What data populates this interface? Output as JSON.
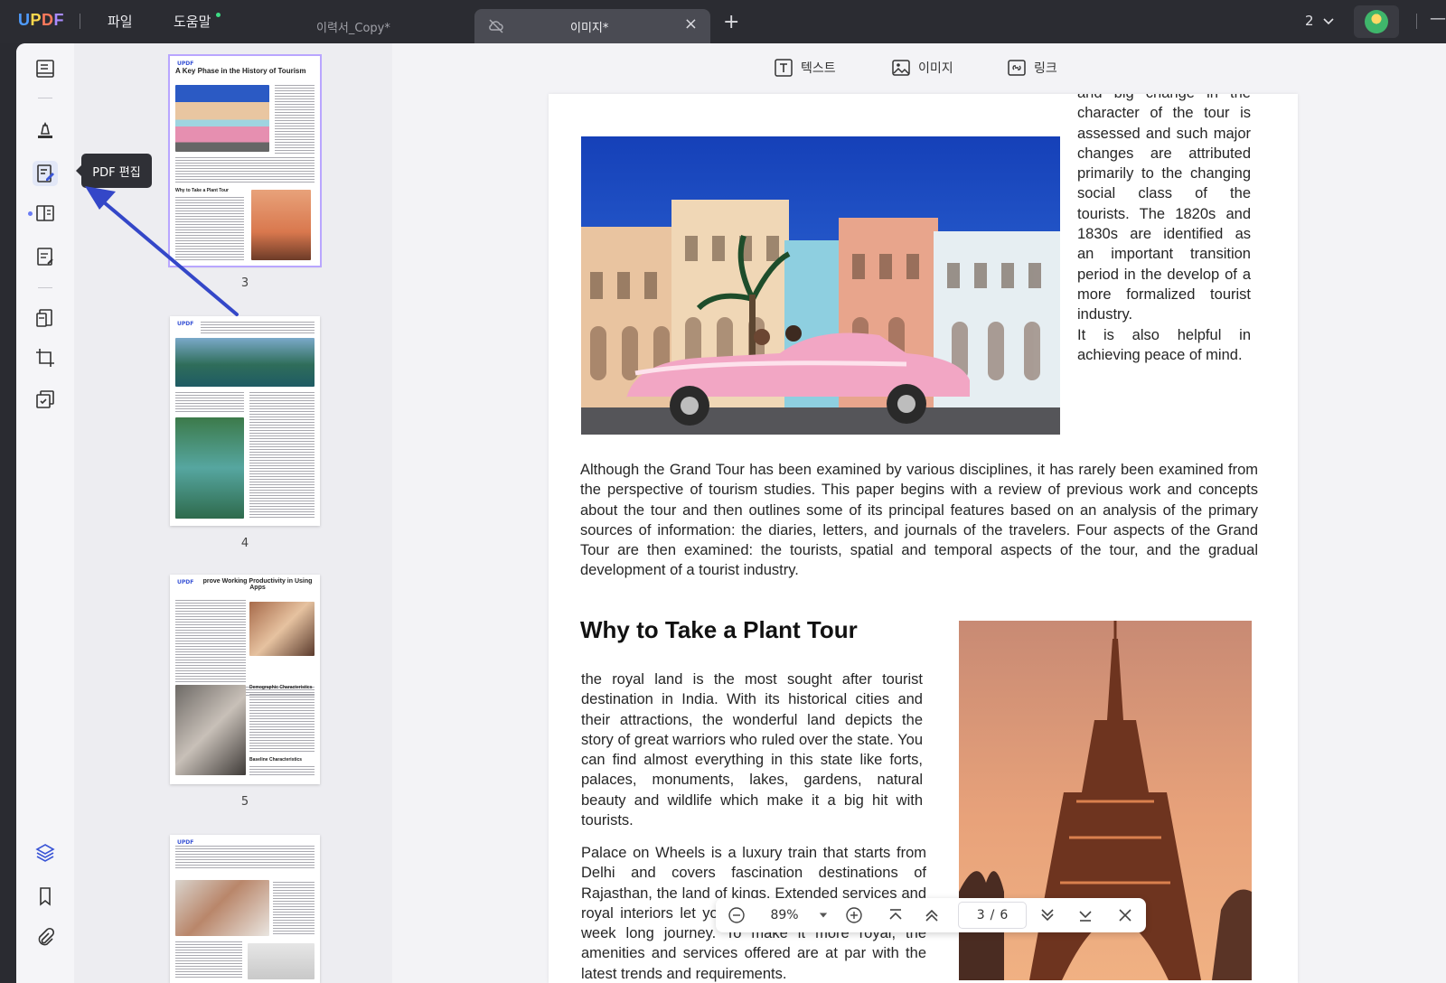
{
  "titlebar": {
    "logo": "UPDF",
    "menu_file": "파일",
    "menu_help": "도움말",
    "tab_inactive": "이력서_Copy*",
    "tab_active": "이미지*",
    "add_tab": "+",
    "window_count": "2",
    "minimize": "—"
  },
  "left_toolbar": {
    "items": [
      "reader-icon",
      "comment-icon",
      "edit-pdf-icon",
      "page-organize-icon",
      "form-icon",
      "convert-icon",
      "crop-icon",
      "protect-icon",
      "layers-icon",
      "bookmark-icon",
      "attachment-icon"
    ],
    "active": "edit-pdf-icon",
    "tooltip": "PDF 편집"
  },
  "thumbnails": {
    "pages": [
      {
        "number": "3",
        "title": "A Key Phase in the History of Tourism",
        "subheading": "Why to Take a Plant Tour",
        "brand": "UPDF"
      },
      {
        "number": "4",
        "brand": "UPDF"
      },
      {
        "number": "5",
        "title": "prove Working Productivity in Using Apps",
        "subheading1": "Demographic Characteristics",
        "subheading2": "Baseline Characteristics",
        "brand": "UPDF"
      },
      {
        "number": "",
        "brand": "UPDF"
      }
    ]
  },
  "edit_toolbar": {
    "text": "텍스트",
    "image": "이미지",
    "link": "링크"
  },
  "page": {
    "side_text_lines": [
      "and big change in the",
      "character of the tour is",
      "assessed and such major",
      "changes are attributed",
      "primarily to the changing",
      "social class of the",
      "tourists. The 1820s and",
      "1830s are identified as",
      "an important transition",
      "period in the develop of a",
      "more formalized tourist",
      "industry.",
      "It is also helpful in",
      "achieving peace of mind."
    ],
    "paragraph1": "Although the Grand Tour has been examined by various disciplines, it has rarely been examined from the perspective of tourism studies. This paper begins with a review of previous work and concepts about the tour and then outlines some of its principal features based on an analysis of the primary sources of information: the diaries, letters, and journals of the travelers. Four aspects of the Grand Tour are then examined: the tourists, spatial and temporal aspects of the tour, and the gradual development of a tourist industry.",
    "heading": "Why to Take a Plant Tour",
    "paragraph2": "the royal land is the most sought after tourist destination in India. With its historical cities and their attractions, the wonderful land depicts the story of great warriors who ruled over the state. You can find almost everything in this state like forts, palaces, monuments, lakes, gardens, natural beauty and wildlife which make it a big hit with tourists.",
    "paragraph3": "Palace on Wheels is a luxury train that starts from Delhi and covers fascination destinations of Rajasthan, the land of kings. Extended services and royal interiors let you feel like a king during the a week long journey. To make it more royal, the amenities and services offered are at par with the latest trends and requirements."
  },
  "nav": {
    "zoom": "89%",
    "current_page": "3",
    "separator": "/",
    "total_pages": "6"
  },
  "colors": {
    "accent": "#3a55d6",
    "titlebar_bg": "#2b2c32",
    "selection": "#b9a6ff"
  }
}
